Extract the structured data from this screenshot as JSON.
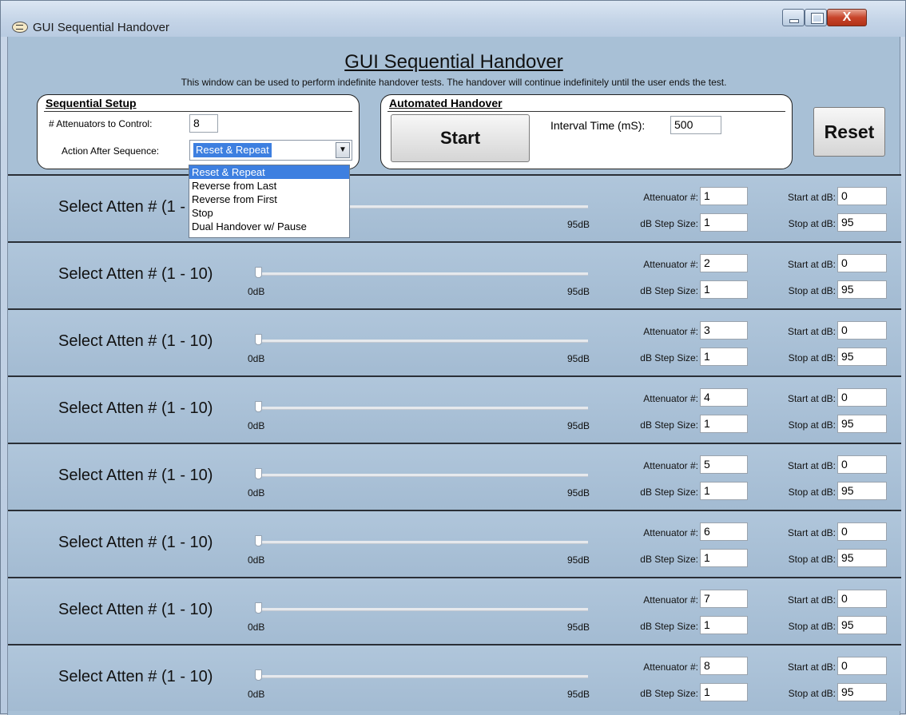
{
  "window": {
    "title": "GUI Sequential Handover",
    "close_glyph": "X"
  },
  "header": {
    "title": "GUI Sequential Handover",
    "subtitle": "This window can be used to perform indefinite handover tests.  The handover will continue indefinitely until the user ends the test."
  },
  "sequential_setup": {
    "title": "Sequential Setup",
    "attenuators_label": "# Attenuators to Control:",
    "attenuators_value": "8",
    "action_label": "Action After Sequence:",
    "action_value": "Reset & Repeat",
    "action_options": [
      "Reset & Repeat",
      "Reverse from Last",
      "Reverse from First",
      "Stop",
      "Dual Handover w/ Pause"
    ]
  },
  "automated_handover": {
    "title": "Automated Handover",
    "start_label": "Start",
    "interval_label": "Interval Time (mS):",
    "interval_value": "500"
  },
  "reset_label": "Reset",
  "rows": [
    {
      "label": "Select Atten # (1 - 10)",
      "slider_min": "0dB",
      "slider_max": "95dB",
      "attenuator": "1",
      "step": "1",
      "start": "0",
      "stop": "95"
    },
    {
      "label": "Select Atten # (1 - 10)",
      "slider_min": "0dB",
      "slider_max": "95dB",
      "attenuator": "2",
      "step": "1",
      "start": "0",
      "stop": "95"
    },
    {
      "label": "Select Atten # (1 - 10)",
      "slider_min": "0dB",
      "slider_max": "95dB",
      "attenuator": "3",
      "step": "1",
      "start": "0",
      "stop": "95"
    },
    {
      "label": "Select Atten # (1 - 10)",
      "slider_min": "0dB",
      "slider_max": "95dB",
      "attenuator": "4",
      "step": "1",
      "start": "0",
      "stop": "95"
    },
    {
      "label": "Select Atten # (1 - 10)",
      "slider_min": "0dB",
      "slider_max": "95dB",
      "attenuator": "5",
      "step": "1",
      "start": "0",
      "stop": "95"
    },
    {
      "label": "Select Atten # (1 - 10)",
      "slider_min": "0dB",
      "slider_max": "95dB",
      "attenuator": "6",
      "step": "1",
      "start": "0",
      "stop": "95"
    },
    {
      "label": "Select Atten # (1 - 10)",
      "slider_min": "0dB",
      "slider_max": "95dB",
      "attenuator": "7",
      "step": "1",
      "start": "0",
      "stop": "95"
    },
    {
      "label": "Select Atten # (1 - 10)",
      "slider_min": "0dB",
      "slider_max": "95dB",
      "attenuator": "8",
      "step": "1",
      "start": "0",
      "stop": "95"
    }
  ],
  "row_field_labels": {
    "attenuator": "Attenuator #:",
    "step": "dB Step Size:",
    "start": "Start at dB:",
    "stop": "Stop at dB:"
  }
}
